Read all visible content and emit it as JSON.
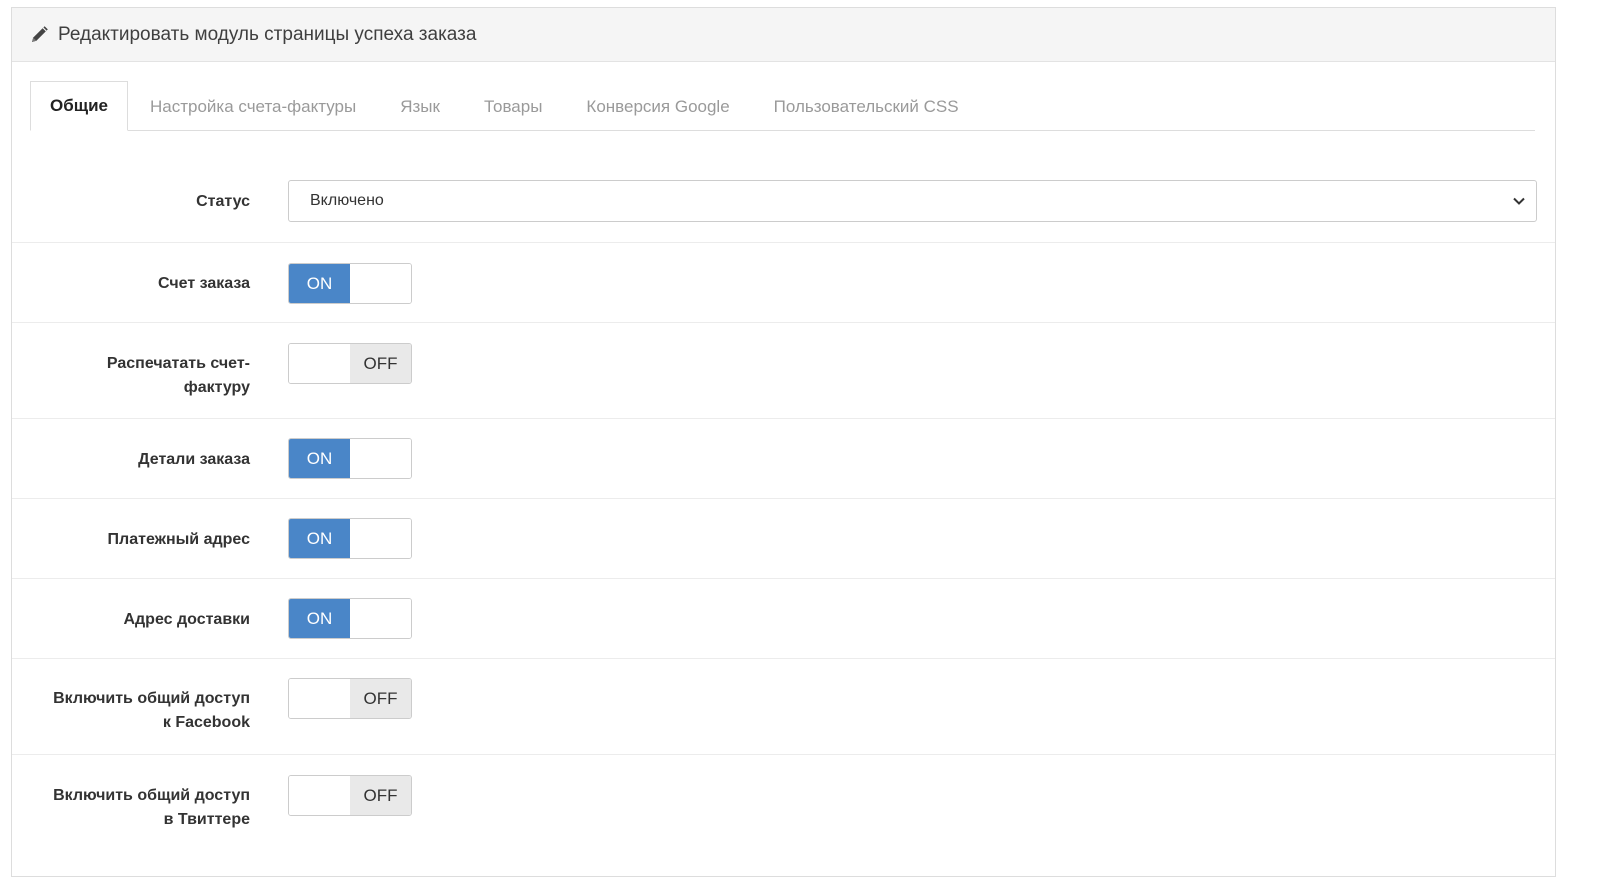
{
  "header": {
    "title": "Редактировать модуль страницы успеха заказа",
    "icon": "pencil-icon"
  },
  "tabs": [
    {
      "label": "Общие",
      "active": true
    },
    {
      "label": "Настройка счета-фактуры",
      "active": false
    },
    {
      "label": "Язык",
      "active": false
    },
    {
      "label": "Товары",
      "active": false
    },
    {
      "label": "Конверсия Google",
      "active": false
    },
    {
      "label": "Пользовательский CSS",
      "active": false
    }
  ],
  "form": {
    "status": {
      "label": "Статус",
      "value": "Включено"
    },
    "toggles": [
      {
        "label_line1": "Счет заказа",
        "label_line2": "",
        "state": "ON"
      },
      {
        "label_line1": "Распечатать счет-",
        "label_line2": "фактуру",
        "state": "OFF"
      },
      {
        "label_line1": "Детали заказа",
        "label_line2": "",
        "state": "ON"
      },
      {
        "label_line1": "Платежный адрес",
        "label_line2": "",
        "state": "ON"
      },
      {
        "label_line1": "Адрес доставки",
        "label_line2": "",
        "state": "ON"
      },
      {
        "label_line1": "Включить общий доступ",
        "label_line2": "к Facebook",
        "state": "OFF"
      },
      {
        "label_line1": "Включить общий доступ",
        "label_line2": "в Твиттере",
        "state": "OFF"
      }
    ]
  },
  "colors": {
    "toggle_on": "#4a86c8",
    "toggle_off": "#e9e9e9",
    "heading_bg": "#f5f5f5"
  }
}
